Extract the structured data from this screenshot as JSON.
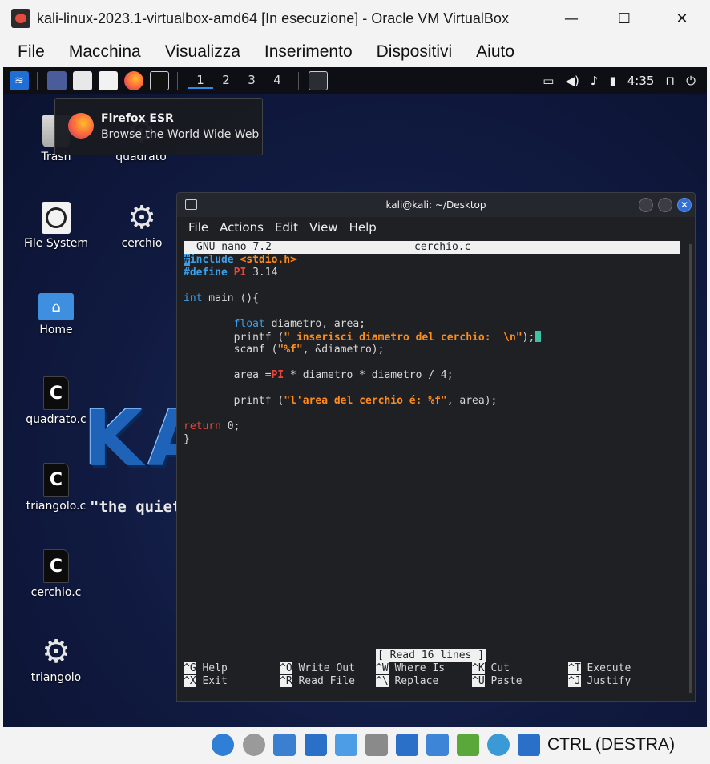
{
  "window": {
    "title": "kali-linux-2023.1-virtualbox-amd64 [In esecuzione] - Oracle VM VirtualBox",
    "minimize": "—",
    "maximize": "☐",
    "close": "✕"
  },
  "host_menu": [
    "File",
    "Macchina",
    "Visualizza",
    "Inserimento",
    "Dispositivi",
    "Aiuto"
  ],
  "panel": {
    "workspaces": [
      "1",
      "2",
      "3",
      "4"
    ],
    "active_workspace": "1",
    "clock": "4:35"
  },
  "tooltip": {
    "title": "Firefox ESR",
    "subtitle": "Browse the World Wide Web"
  },
  "desktop_icons": [
    "Trash",
    "quadrato",
    "File System",
    "cerchio",
    "Home",
    "quadrato.c",
    "triangolo.c",
    "cerchio.c",
    "triangolo"
  ],
  "desktop_file_glyph": "C",
  "watermark": {
    "logo": "KALI LINUX",
    "tagline": "\"the quieter you become, the more you are able to hear\""
  },
  "terminal": {
    "title": "kali@kali: ~/Desktop",
    "close_glyph": "✕",
    "menu": [
      "File",
      "Actions",
      "Edit",
      "View",
      "Help"
    ],
    "nano_version": "GNU nano 7.2",
    "filename": "cerchio.c",
    "code": {
      "l1_hash": "#",
      "l1_directive": "include",
      "l1_header": "<stdio.h>",
      "l2_directive": "#define",
      "l2_name": "PI",
      "l2_value": "3.14",
      "l4_type": "int",
      "l4_rest": " main (){",
      "l6_indent": "        ",
      "l6_type": "float",
      "l6_rest": " diametro, area;",
      "l7_pre": "        printf (",
      "l7_str": "\" inserisci diametro del cerchio:  \\n\"",
      "l7_post": ");",
      "l8_pre": "        scanf (",
      "l8_str": "\"%f\"",
      "l8_post": ", &diametro);",
      "l10_pre": "        area =",
      "l10_pi": "PI",
      "l10_post": " * diametro * diametro / 4;",
      "l12_pre": "        printf (",
      "l12_str": "\"l'area del cerchio é: %f\"",
      "l12_post": ", area);",
      "l14_kw": "return",
      "l14_rest": " 0;",
      "l15": "}"
    },
    "status": "[ Read 16 lines ]",
    "shortcuts": [
      {
        "key": "^G",
        "label": " Help"
      },
      {
        "key": "^X",
        "label": " Exit"
      },
      {
        "key": "^O",
        "label": " Write Out"
      },
      {
        "key": "^R",
        "label": " Read File"
      },
      {
        "key": "^W",
        "label": " Where Is"
      },
      {
        "key": "^\\",
        "label": " Replace"
      },
      {
        "key": "^K",
        "label": " Cut"
      },
      {
        "key": "^U",
        "label": " Paste"
      },
      {
        "key": "^T",
        "label": " Execute"
      },
      {
        "key": "^J",
        "label": " Justify"
      }
    ]
  },
  "host_status": {
    "host_key": "CTRL (DESTRA)"
  },
  "colors": {
    "accent_blue": "#3b9fe8",
    "string_orange": "#ff8c1a",
    "keyword_red": "#e8453c",
    "cursor_teal": "#3fc1a5"
  }
}
